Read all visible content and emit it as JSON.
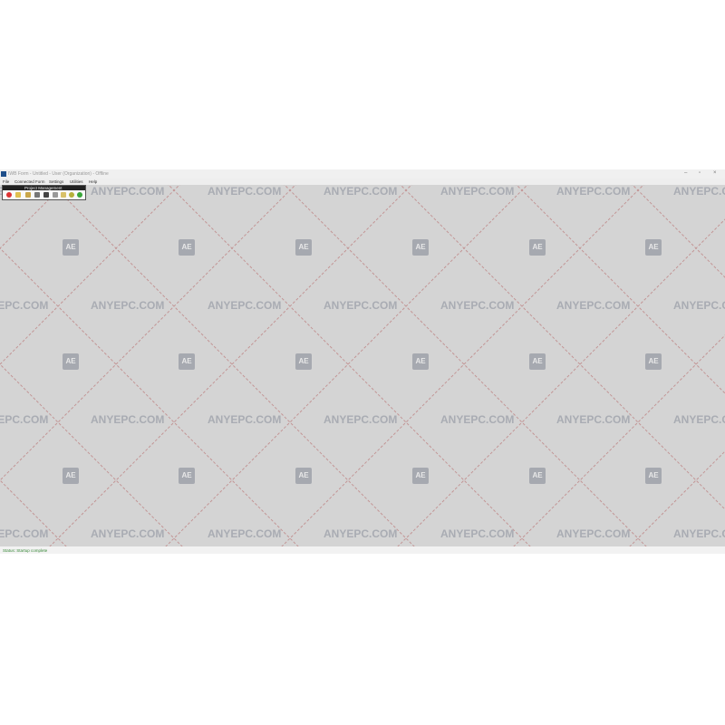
{
  "window": {
    "title": "IWB Form - Untitled - User (Organization) - Offline"
  },
  "menu": [
    "File",
    "Connected Form",
    "Settings",
    "Utilities",
    "Help"
  ],
  "toolbar": {
    "label": "Project Management",
    "icons": [
      "stop-icon",
      "open-icon",
      "folder-icon",
      "settings-icon",
      "save-icon",
      "print-icon",
      "edit-icon",
      "info-icon",
      "run-icon"
    ]
  },
  "watermark": {
    "text": "ANYEPC.COM",
    "badge": "AE"
  },
  "status": {
    "text": "Status: Startup complete"
  },
  "colors": {
    "workspace": "#d4d4d4",
    "watermark": "#a9acb3",
    "pattern_line": "#c08b8b",
    "status_text": "#3a8a3a"
  }
}
